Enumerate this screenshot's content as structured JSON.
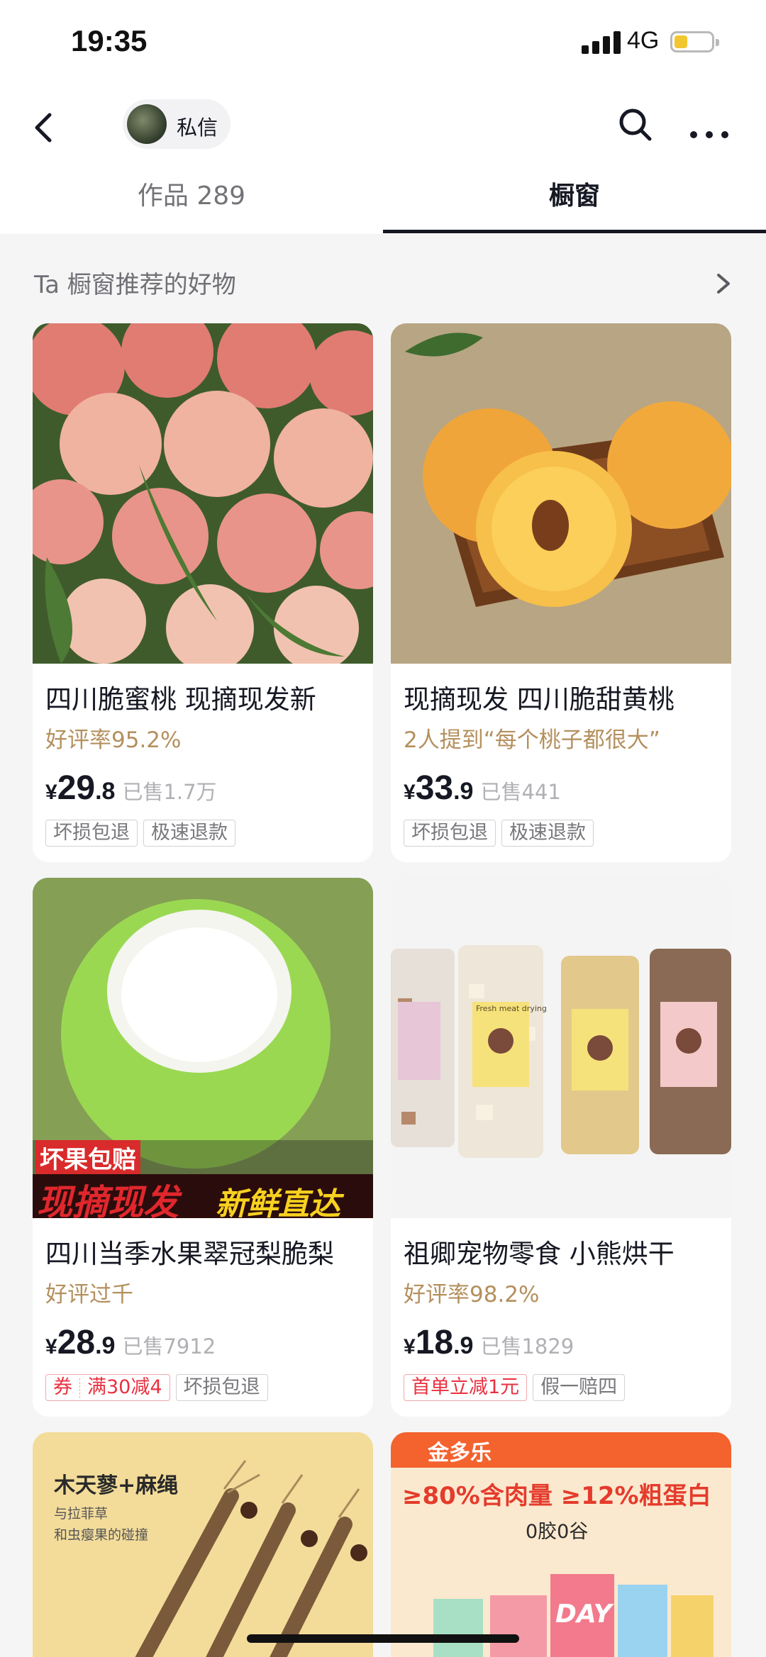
{
  "status_bar": {
    "time": "19:35",
    "network": "4G",
    "battery_level": 0.35,
    "battery_color": "#f2c62e"
  },
  "nav": {
    "back_icon": "chevron-left-icon",
    "chat_label": "私信",
    "search_icon": "search-icon",
    "more_icon": "more-horizontal-icon"
  },
  "tabs": [
    {
      "label": "作品 289",
      "active": false
    },
    {
      "label": "橱窗",
      "active": true
    }
  ],
  "section": {
    "title": "Ta 橱窗推荐的好物"
  },
  "products": [
    {
      "name": "四川脆蜜桃 现摘现发新",
      "subtitle": "好评率95.2%",
      "price_symbol": "¥",
      "price_int": "29",
      "price_dec": ".8",
      "sold": "已售1.7万",
      "tags": [
        "坏损包退",
        "极速退款"
      ],
      "image": "white-peaches-photo"
    },
    {
      "name": "现摘现发 四川脆甜黄桃",
      "subtitle": "2人提到“每个桃子都很大”",
      "price_symbol": "¥",
      "price_int": "33",
      "price_dec": ".9",
      "sold": "已售441",
      "tags": [
        "坏损包退",
        "极速退款"
      ],
      "image": "yellow-peaches-photo"
    },
    {
      "name": "四川当季水果翠冠梨脆梨",
      "subtitle": "好评过千",
      "price_symbol": "¥",
      "price_int": "28",
      "price_dec": ".9",
      "sold": "已售7912",
      "coupon_label": "券",
      "coupon_text": "满30减4",
      "tags": [
        "坏损包退"
      ],
      "image": "green-pear-photo",
      "banner_small": "坏果包赔",
      "banner_left": "现摘现发",
      "banner_right": "新鲜直达"
    },
    {
      "name": "祖卿宠物零食 小熊烘干",
      "subtitle": "好评率98.2%",
      "price_symbol": "¥",
      "price_int": "18",
      "price_dec": ".9",
      "sold": "已售1829",
      "promo_tag": "首单立减1元",
      "tags": [
        "假一赔四"
      ],
      "image": "pet-snack-jars-photo",
      "jar_label": "Fresh meat drying"
    },
    {
      "image": "catnip-sticks-photo",
      "image_title": "木天蓼+麻绳",
      "image_caption_1": "与拉菲草",
      "image_caption_2": "和虫瘿果的碰撞"
    },
    {
      "image": "cat-treat-package-photo",
      "brand": "金多乐",
      "headline": "≥80%含肉量 ≥12%粗蛋白",
      "subline": "0胶0谷",
      "pack_text": "DAY"
    }
  ]
}
